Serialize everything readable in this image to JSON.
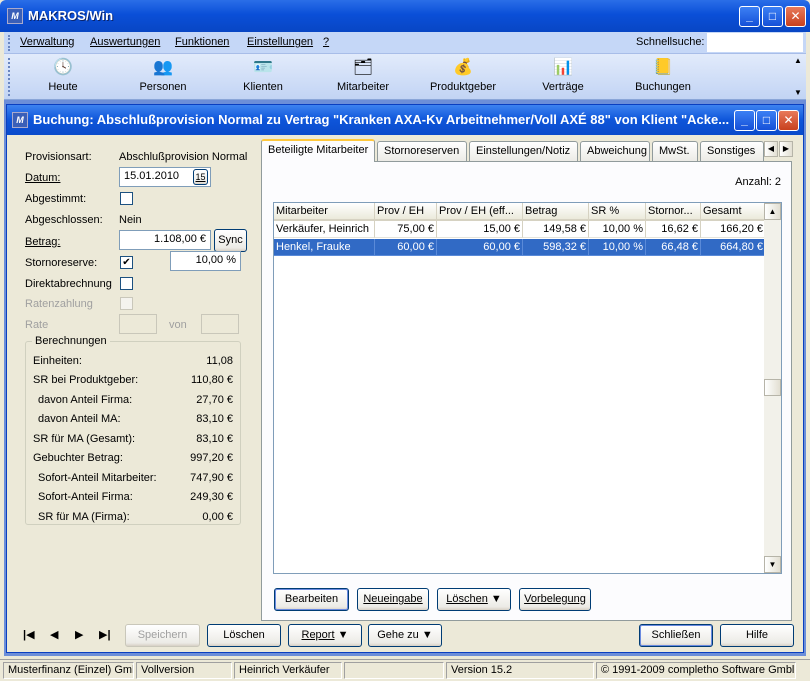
{
  "app": {
    "title": "MAKROS/Win",
    "icon": "M"
  },
  "menu": {
    "items": [
      "Verwaltung",
      "Auswertungen",
      "Funktionen",
      "Einstellungen",
      "?"
    ],
    "quicksearch_label": "Schnellsuche:",
    "quicksearch_value": ""
  },
  "toolbar": {
    "items": [
      {
        "label": "Heute",
        "icon": "calendar-clock-icon",
        "glyph": "🕓"
      },
      {
        "label": "Personen",
        "icon": "people-icon",
        "glyph": "👥"
      },
      {
        "label": "Klienten",
        "icon": "id-card-icon",
        "glyph": "🪪"
      },
      {
        "label": "Mitarbeiter",
        "icon": "org-tree-icon",
        "glyph": "🗂"
      },
      {
        "label": "Produktgeber",
        "icon": "coins-icon",
        "glyph": "💰"
      },
      {
        "label": "Verträge",
        "icon": "chart-icon",
        "glyph": "📊"
      },
      {
        "label": "Buchungen",
        "icon": "ledger-icon",
        "glyph": "📒"
      }
    ]
  },
  "window": {
    "title": "Buchung: Abschlußprovision Normal zu Vertrag \"Kranken AXA-Kv Arbeitnehmer/Voll AXÉ 88\" von Klient \"Acke..."
  },
  "form": {
    "provisionsart_label": "Provisionsart:",
    "provisionsart_value": "Abschlußprovision Normal",
    "datum_label": "Datum:",
    "datum_value": "15.01.2010",
    "datum_btn": "15",
    "abgestimmt_label": "Abgestimmt:",
    "abgeschlossen_label": "Abgeschlossen:",
    "abgeschlossen_value": "Nein",
    "betrag_label": "Betrag:",
    "betrag_value": "1.108,00 €",
    "sync_label": "Sync",
    "stornoreserve_label": "Stornoreserve:",
    "stornoreserve_check": "✔",
    "stornoreserve_value": "10,00 %",
    "direktabrechnung_label": "Direktabrechnung",
    "ratenzahlung_label": "Ratenzahlung",
    "rate_label": "Rate",
    "von_label": "von"
  },
  "berechnungen": {
    "title": "Berechnungen",
    "rows": [
      {
        "k": "Einheiten:",
        "v": "11,08",
        "indent": 0
      },
      {
        "k": "SR bei Produktgeber:",
        "v": "110,80 €",
        "indent": 0
      },
      {
        "k": "davon Anteil Firma:",
        "v": "27,70 €",
        "indent": 5
      },
      {
        "k": "davon Anteil MA:",
        "v": "83,10 €",
        "indent": 5
      },
      {
        "k": "SR für MA (Gesamt):",
        "v": "83,10 €",
        "indent": 0
      },
      {
        "k": "Gebuchter Betrag:",
        "v": "997,20 €",
        "indent": 0
      },
      {
        "k": "Sofort-Anteil Mitarbeiter:",
        "v": "747,90 €",
        "indent": 5
      },
      {
        "k": "Sofort-Anteil Firma:",
        "v": "249,30 €",
        "indent": 5
      },
      {
        "k": "SR für MA (Firma):",
        "v": "0,00 €",
        "indent": 5
      }
    ]
  },
  "tabs": [
    "Beteiligte Mitarbeiter",
    "Stornoreserven",
    "Einstellungen/Notiz",
    "Abweichung",
    "MwSt.",
    "Sonstiges"
  ],
  "grid": {
    "count_label": "Anzahl: 2",
    "columns": [
      "Mitarbeiter",
      "Prov / EH",
      "Prov / EH (eff...",
      "Betrag",
      "SR %",
      "Stornor...",
      "Gesamt"
    ],
    "rows": [
      [
        "Verkäufer, Heinrich",
        "75,00 €",
        "15,00 €",
        "149,58 €",
        "10,00 %",
        "16,62 €",
        "166,20 €"
      ],
      [
        "Henkel, Frauke",
        "60,00 €",
        "60,00 €",
        "598,32 €",
        "10,00 %",
        "66,48 €",
        "664,80 €"
      ]
    ]
  },
  "panel_buttons": {
    "edit": "Bearbeiten",
    "new": "Neueingabe",
    "delete": "Löschen",
    "template": "Vorbelegung"
  },
  "bottom_buttons": {
    "save": "Speichern",
    "delete": "Löschen",
    "report": "Report",
    "goto": "Gehe zu",
    "close": "Schließen",
    "help": "Hilfe"
  },
  "statusbar": [
    "Musterfinanz (Einzel) Gmb",
    "Vollversion",
    "Heinrich Verkäufer",
    "",
    "Version 15.2",
    "© 1991-2009 completho Software Gmbl"
  ]
}
